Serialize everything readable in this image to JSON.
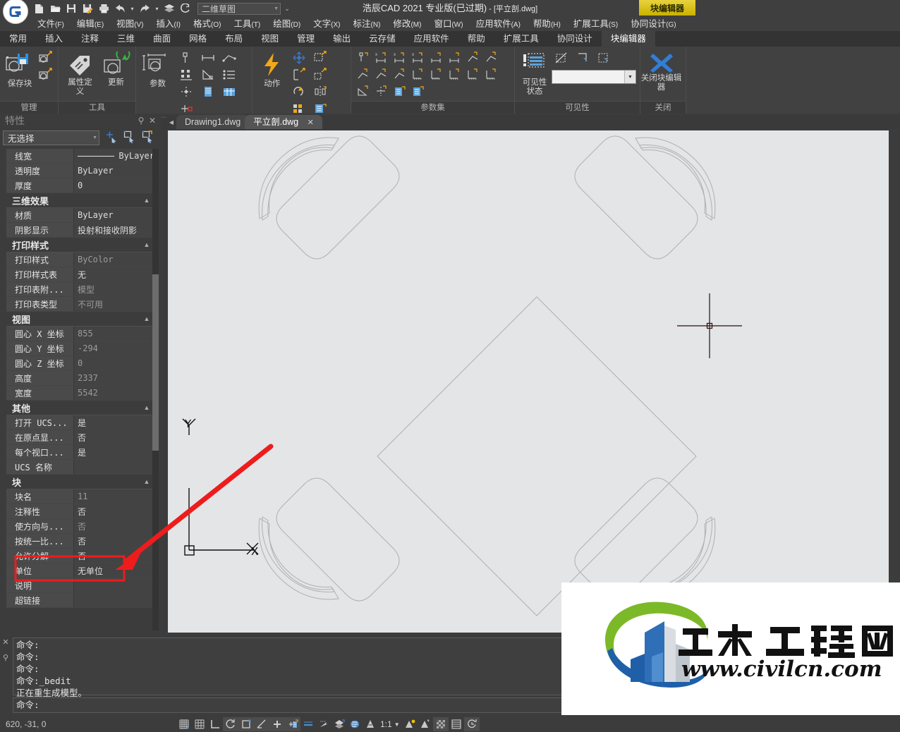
{
  "title_bar": {
    "app_title_main": "浩辰CAD 2021 专业版(已过期)",
    "app_title_doc": " - [平立剖.dwg]",
    "workspace_value": "二维草图",
    "block_editor_badge": "块编辑器",
    "quick_access": [
      {
        "name": "new-icon",
        "tip": "新建"
      },
      {
        "name": "open-icon",
        "tip": "打开"
      },
      {
        "name": "save-icon",
        "tip": "保存"
      },
      {
        "name": "save-as-icon",
        "tip": "另存为"
      },
      {
        "name": "print-icon",
        "tip": "打印"
      },
      {
        "name": "undo-icon",
        "tip": "放弃"
      },
      {
        "name": "redo-icon",
        "tip": "重做"
      },
      {
        "name": "layers-icon",
        "tip": "图层"
      },
      {
        "name": "help-icon",
        "tip": "帮助"
      }
    ]
  },
  "menu_bar": [
    {
      "label": "文件",
      "key": "(F)"
    },
    {
      "label": "编辑",
      "key": "(E)"
    },
    {
      "label": "视图",
      "key": "(V)"
    },
    {
      "label": "插入",
      "key": "(I)"
    },
    {
      "label": "格式",
      "key": "(O)"
    },
    {
      "label": "工具",
      "key": "(T)"
    },
    {
      "label": "绘图",
      "key": "(D)"
    },
    {
      "label": "文字",
      "key": "(X)"
    },
    {
      "label": "标注",
      "key": "(N)"
    },
    {
      "label": "修改",
      "key": "(M)"
    },
    {
      "label": "窗口",
      "key": "(W)"
    },
    {
      "label": "应用软件",
      "key": "(A)"
    },
    {
      "label": "帮助",
      "key": "(H)"
    },
    {
      "label": "扩展工具",
      "key": "(S)"
    },
    {
      "label": "协同设计",
      "key": "(G)"
    }
  ],
  "ribbon_tabs": [
    {
      "label": "常用",
      "active": false
    },
    {
      "label": "插入",
      "active": false
    },
    {
      "label": "注释",
      "active": false
    },
    {
      "label": "三维",
      "active": false
    },
    {
      "label": "曲面",
      "active": false
    },
    {
      "label": "网格",
      "active": false
    },
    {
      "label": "布局",
      "active": false
    },
    {
      "label": "视图",
      "active": false
    },
    {
      "label": "管理",
      "active": false
    },
    {
      "label": "输出",
      "active": false
    },
    {
      "label": "云存储",
      "active": false
    },
    {
      "label": "应用软件",
      "active": false
    },
    {
      "label": "帮助",
      "active": false
    },
    {
      "label": "扩展工具",
      "active": false
    },
    {
      "label": "协同设计",
      "active": false
    },
    {
      "label": "块编辑器",
      "active": true
    }
  ],
  "ribbon_panels": {
    "manage": {
      "label": "管理",
      "save_block_label": "保存块",
      "buttons": [
        "保存块",
        "测试块",
        "另存块为"
      ]
    },
    "tools": {
      "label": "工具",
      "attr_def_label": "属性定义",
      "update_label": "更新"
    },
    "parameters": {
      "label": "参数",
      "main_label": "参数",
      "items": [
        "点参数",
        "线性参数",
        "极轴参数",
        "可见性参数",
        "对齐参数",
        "查寻参数",
        "基点参数",
        "块表",
        "块特性表"
      ]
    },
    "actions": {
      "label": "动作",
      "main_label": "动作",
      "items": [
        "移动动作",
        "缩放动作",
        "拉伸动作",
        "极轴拉伸动作",
        "旋转动作",
        "翻转动作",
        "阵列动作",
        "查寻动作"
      ]
    },
    "parameter_sets": {
      "label": "参数集",
      "count": 20
    },
    "visibility": {
      "label": "可见性",
      "state_label": "可见性状态",
      "combo_value": "",
      "buttons": [
        "使不可见",
        "使可见",
        "可见性模式"
      ]
    },
    "close": {
      "label": "关闭",
      "close_label": "关闭块编辑器"
    }
  },
  "properties_panel": {
    "title": "特性",
    "pin_icon": "pin-icon",
    "close_icon": "close-icon",
    "selection_value": "无选择",
    "tool_icons": [
      "quick-select-icon",
      "select-object-icon",
      "match-properties-icon"
    ],
    "groups": [
      {
        "name": "",
        "is_header": false,
        "rows": [
          {
            "label": "线宽",
            "value": "ByLayer",
            "gray": false,
            "lineweight": true
          },
          {
            "label": "透明度",
            "value": "ByLayer",
            "gray": false
          },
          {
            "label": "厚度",
            "value": "0",
            "gray": false
          }
        ]
      },
      {
        "name": "三维效果",
        "is_header": true,
        "rows": [
          {
            "label": "材质",
            "value": "ByLayer",
            "gray": false
          },
          {
            "label": "阴影显示",
            "value": "投射和接收阴影",
            "gray": false
          }
        ]
      },
      {
        "name": "打印样式",
        "is_header": true,
        "rows": [
          {
            "label": "打印样式",
            "value": "ByColor",
            "gray": true
          },
          {
            "label": "打印样式表",
            "value": "无",
            "gray": false
          },
          {
            "label": "打印表附...",
            "value": "模型",
            "gray": true
          },
          {
            "label": "打印表类型",
            "value": "不可用",
            "gray": true
          }
        ]
      },
      {
        "name": "视图",
        "is_header": true,
        "rows": [
          {
            "label": "圆心 X 坐标",
            "value": "855",
            "gray": true
          },
          {
            "label": "圆心 Y 坐标",
            "value": "-294",
            "gray": true
          },
          {
            "label": "圆心 Z 坐标",
            "value": "0",
            "gray": true
          },
          {
            "label": "高度",
            "value": "2337",
            "gray": true
          },
          {
            "label": "宽度",
            "value": "5542",
            "gray": true
          }
        ]
      },
      {
        "name": "其他",
        "is_header": true,
        "rows": [
          {
            "label": "打开 UCS...",
            "value": "是",
            "gray": false
          },
          {
            "label": "在原点显...",
            "value": "否",
            "gray": false
          },
          {
            "label": "每个视口...",
            "value": "是",
            "gray": false
          },
          {
            "label": "UCS 名称",
            "value": "",
            "gray": false
          }
        ]
      },
      {
        "name": "块",
        "is_header": true,
        "rows": [
          {
            "label": "块名",
            "value": "11",
            "gray": true
          },
          {
            "label": "注释性",
            "value": "否",
            "gray": false
          },
          {
            "label": "使方向与...",
            "value": "否",
            "gray": true
          },
          {
            "label": "按统一比...",
            "value": "否",
            "gray": false
          },
          {
            "label": "允许分解",
            "value": "否",
            "gray": false,
            "highlighted": true
          },
          {
            "label": "单位",
            "value": "无单位",
            "gray": false
          },
          {
            "label": "说明",
            "value": "",
            "gray": false
          },
          {
            "label": "超链接",
            "value": "",
            "gray": false
          }
        ]
      }
    ]
  },
  "document_tabs": [
    {
      "label": "Drawing1.dwg",
      "active": false,
      "closable": false
    },
    {
      "label": "平立剖.dwg",
      "active": true,
      "closable": true
    }
  ],
  "canvas": {
    "background_color": "#e3e5e7",
    "crosshair_color": "#2b0c0c",
    "drawing_description": "四人餐桌平面图（方桌旋转45度配四把椅子）",
    "ucs": {
      "x_label": "X",
      "y_label": "Y"
    }
  },
  "command_line": {
    "history": [
      "命令:",
      "命令:",
      "命令:",
      "命令:_bedit",
      "正在重生成模型。"
    ],
    "prompt": "命令:",
    "close_icon": "close-icon",
    "pin_icon": "pin-icon"
  },
  "status_bar": {
    "coordinates": "620, -31, 0",
    "scale": "1:1",
    "icons": [
      {
        "name": "snap-grid-icon",
        "active": false
      },
      {
        "name": "grid-display-icon",
        "active": false
      },
      {
        "name": "ortho-mode-icon",
        "active": false
      },
      {
        "name": "polar-tracking-icon",
        "active": true
      },
      {
        "name": "object-snap-icon",
        "active": true
      },
      {
        "name": "object-snap-tracking-icon",
        "active": true
      },
      {
        "name": "dynamic-ucs-icon",
        "active": true
      },
      {
        "name": "dynamic-input-icon",
        "active": true
      },
      {
        "name": "lineweight-icon",
        "active": false
      },
      {
        "name": "transparency-icon",
        "active": false
      },
      {
        "name": "selection-cycling-icon",
        "active": false
      },
      {
        "name": "layer-icon",
        "active": false
      },
      {
        "name": "quick-properties-icon",
        "active": false
      },
      {
        "name": "annotation-visibility-icon",
        "active": false
      },
      {
        "name": "annotation-scale-add-icon",
        "active": false
      },
      {
        "name": "annotation-autoscale-icon",
        "active": false
      },
      {
        "name": "workspace-switch-icon",
        "active": true
      },
      {
        "name": "hardware-accel-icon",
        "active": false
      },
      {
        "name": "clean-screen-icon",
        "active": true
      }
    ]
  },
  "annotation": {
    "arrow_color": "#ee1c1c",
    "box_color": "#ee1c1c",
    "target_label": "允许分解"
  },
  "watermark": {
    "brand_cn": "土木工程网",
    "brand_url": "www.civilcn.com",
    "color_green": "#7cb928",
    "color_blue": "#1f5fa8",
    "color_light_blue": "#4f8fd0"
  }
}
